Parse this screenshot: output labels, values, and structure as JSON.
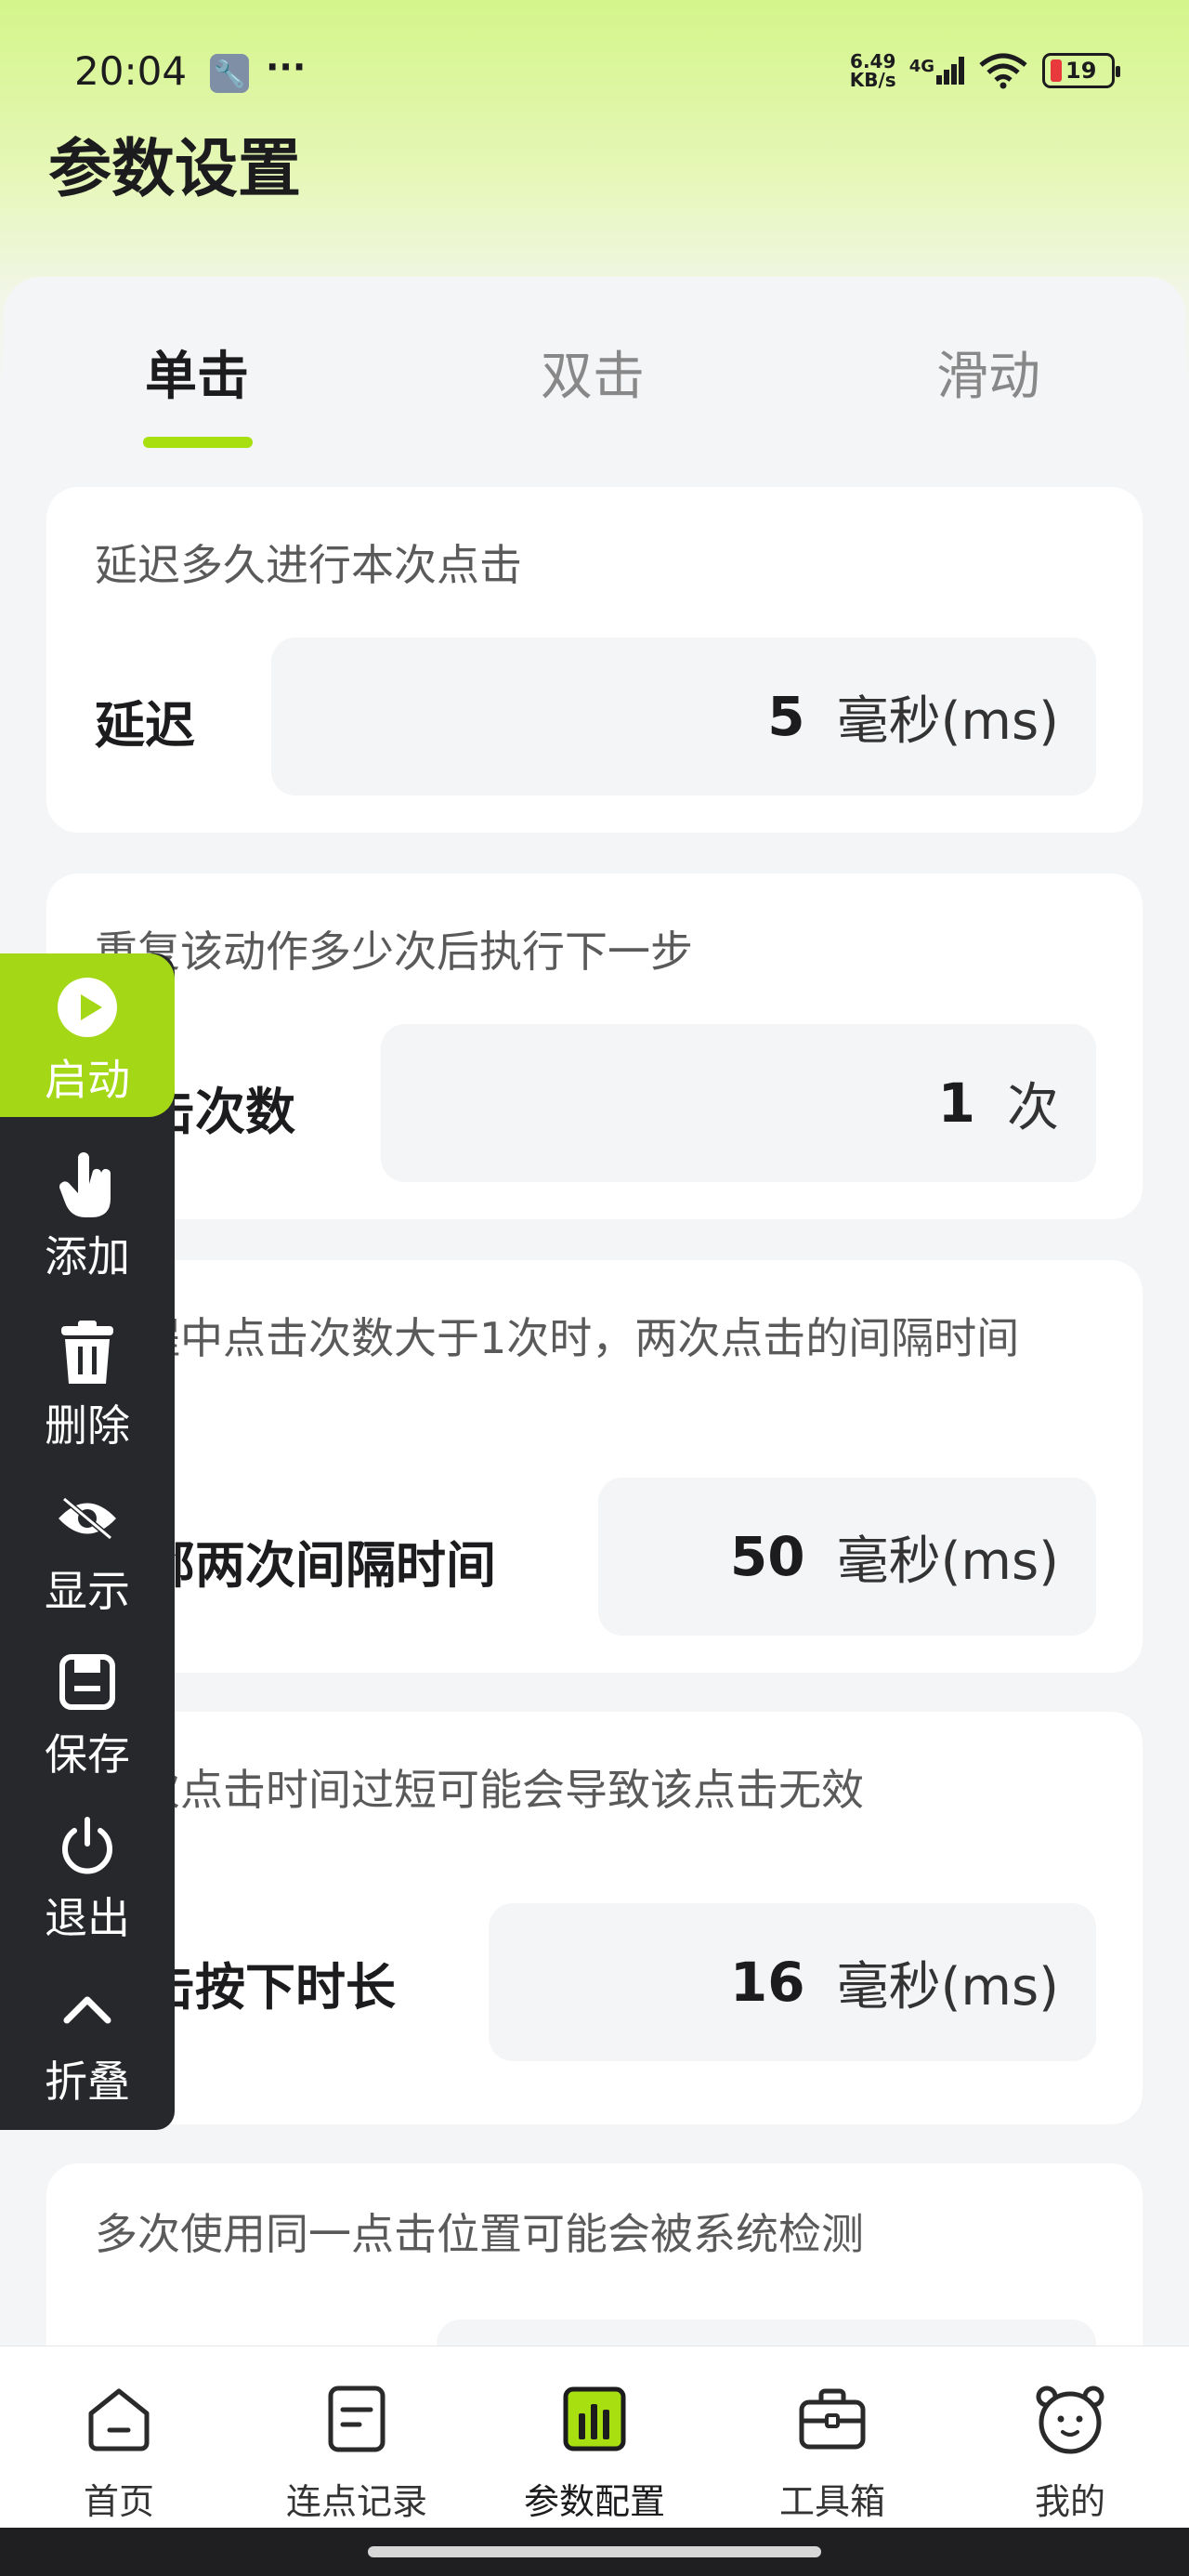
{
  "status_bar": {
    "time": "20:04",
    "dots": "···",
    "net_speed_value": "6.49",
    "net_speed_unit": "KB/s",
    "network_type": "4G",
    "battery_level": "19"
  },
  "page": {
    "title": "参数设置"
  },
  "tabs": [
    {
      "label": "单击",
      "active": true
    },
    {
      "label": "双击",
      "active": false
    },
    {
      "label": "滑动",
      "active": false
    }
  ],
  "settings": [
    {
      "description": "延迟多久进行本次点击",
      "label": "延迟",
      "value": "5",
      "unit": "毫秒(ms)"
    },
    {
      "description": "重复该动作多少次后执行下一步",
      "label": "点击次数",
      "value": "1",
      "unit": "次"
    },
    {
      "description": "流程中点击次数大于1次时，两次点击的间隔时间",
      "label": "相邻两次间隔时间",
      "value": "50",
      "unit": "毫秒(ms)"
    },
    {
      "description": "单次点击时间过短可能会导致该点击无效",
      "label": "点击按下时长",
      "value": "16",
      "unit": "毫秒(ms)"
    },
    {
      "description": "多次使用同一点击位置可能会被系统检测"
    }
  ],
  "float_toolbar": {
    "start": "启动",
    "add": "添加",
    "delete": "删除",
    "show": "显示",
    "save": "保存",
    "exit": "退出",
    "collapse": "折叠"
  },
  "bottom_nav": [
    {
      "label": "首页",
      "icon": "home-icon"
    },
    {
      "label": "连点记录",
      "icon": "record-icon"
    },
    {
      "label": "参数配置",
      "icon": "config-icon",
      "active": true
    },
    {
      "label": "工具箱",
      "icon": "toolbox-icon"
    },
    {
      "label": "我的",
      "icon": "profile-icon"
    }
  ],
  "colors": {
    "accent": "#a7df10",
    "toolbar_dark": "#26282c",
    "start_green": "#a4d816"
  }
}
